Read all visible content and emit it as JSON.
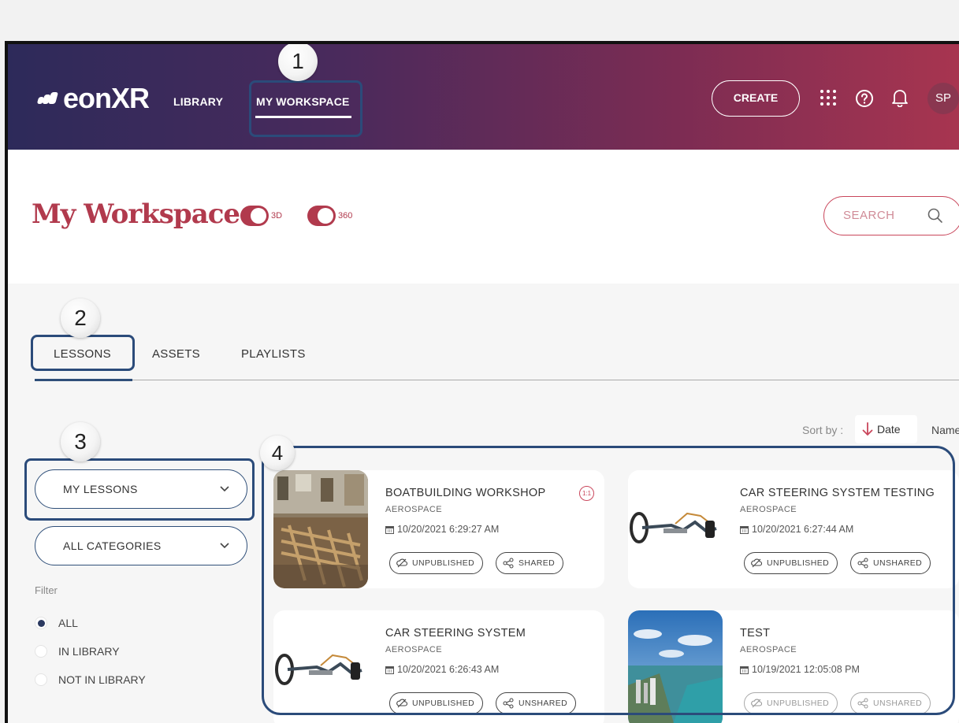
{
  "header": {
    "logo_text": "eonXR",
    "nav": {
      "library": "LIBRARY",
      "my_workspace": "MY WORKSPACE"
    },
    "create_label": "CREATE",
    "avatar_initials": "SP",
    "gradient_colors": [
      "#2d2a5a",
      "#a83550"
    ]
  },
  "page": {
    "title": "My Workspace",
    "toggle_3d_label": "3D",
    "toggle_360_label": "360",
    "search_placeholder": "SEARCH",
    "accent_color": "#b13a4d"
  },
  "tabs": [
    "LESSONS",
    "ASSETS",
    "PLAYLISTS"
  ],
  "active_tab": "LESSONS",
  "sort": {
    "label": "Sort by :",
    "date": "Date",
    "name": "Name"
  },
  "filters": {
    "lessons_select": "MY LESSONS",
    "categories_select": "ALL CATEGORIES",
    "filter_title": "Filter",
    "options": [
      "ALL",
      "IN LIBRARY",
      "NOT IN LIBRARY"
    ],
    "selected": "ALL"
  },
  "cards": [
    {
      "title": "BOATBUILDING WORKSHOP",
      "category": "AEROSPACE",
      "date": "10/20/2021 6:29:27 AM",
      "publish": "UNPUBLISHED",
      "share": "SHARED",
      "badge": "1:1"
    },
    {
      "title": "CAR STEERING SYSTEM TESTING",
      "category": "AEROSPACE",
      "date": "10/20/2021 6:27:44 AM",
      "publish": "UNPUBLISHED",
      "share": "UNSHARED"
    },
    {
      "title": "CAR STEERING SYSTEM",
      "category": "AEROSPACE",
      "date": "10/20/2021 6:26:43 AM",
      "publish": "UNPUBLISHED",
      "share": "UNSHARED"
    },
    {
      "title": "TEST",
      "category": "AEROSPACE",
      "date": "10/19/2021 12:05:08 PM",
      "publish": "UNPUBLISHED",
      "share": "UNSHARED"
    }
  ],
  "callouts": [
    "1",
    "2",
    "3",
    "4"
  ],
  "icons": [
    "apps-grid-icon",
    "help-icon",
    "bell-icon",
    "search-icon",
    "chevron-down-icon",
    "calendar-icon",
    "unpublished-icon",
    "share-icon",
    "sort-down-arrow-icon"
  ]
}
